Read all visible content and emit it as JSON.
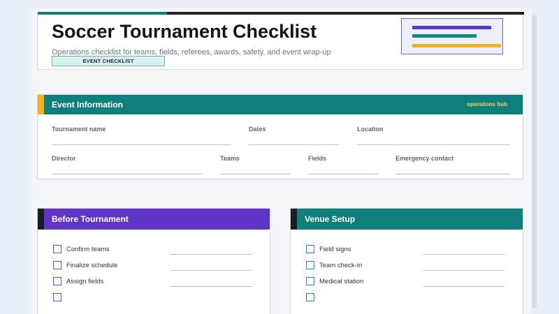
{
  "header": {
    "title": "Soccer Tournament Checklist",
    "subtitle": "Operations checklist for teams, fields, referees, awards, safety, and event wrap-up",
    "pill": "EVENT CHECKLIST",
    "colors": {
      "teal": "#0f7f7b",
      "purple": "#5c36c9",
      "gold": "#f0b31b",
      "dark": "#1d1f2b"
    }
  },
  "event_info": {
    "title": "Event Information",
    "tag": "operations hub",
    "fields": {
      "tournament_name": "Tournament name",
      "dates": "Dates",
      "location": "Location",
      "director": "Director",
      "teams": "Teams",
      "fields": "Fields",
      "emergency_contact": "Emergency contact"
    }
  },
  "before_tournament": {
    "title": "Before Tournament",
    "items": [
      "Confirm teams",
      "Finalize schedule",
      "Assign fields"
    ]
  },
  "venue_setup": {
    "title": "Venue Setup",
    "items": [
      "Field signs",
      "Team check-in",
      "Medical station"
    ]
  }
}
